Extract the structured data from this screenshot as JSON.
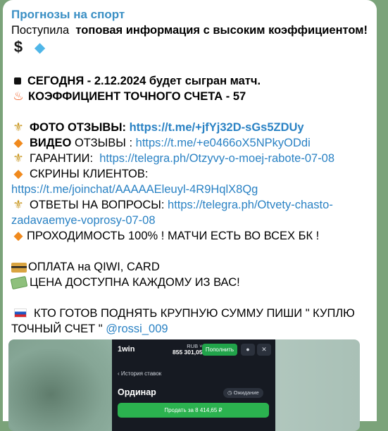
{
  "channel_name": "Прогнозы на спорт",
  "msg": {
    "intro_prefix": "Поступила",
    "intro_bold": "топовая информация с высоким  коэффициентом!",
    "today": "СЕГОДНЯ - 2.12.2024 будет сыгран матч.",
    "coef": "КОЭФФИЦИЕНТ ТОЧНОГО СЧЕТА  - 57",
    "photo_label": "ФОТО ОТЗЫВЫ:",
    "photo_link": "https://t.me/+jfYj32D-sGs5ZDUy",
    "video_bold": "ВИДЕО",
    "video_rest": " ОТЗЫВЫ :",
    "video_link": "https://t.me/+e0466oX5NPkyODdi",
    "guarantee_label": "ГАРАНТИИ:",
    "guarantee_link": "https://telegra.ph/Otzyvy-o-moej-rabote-07-08",
    "screens_label": "СКРИНЫ КЛИЕНТОВ:",
    "screens_link": "https://t.me/joinchat/AAAAAEleuyl-4R9HqlX8Qg",
    "answers_label": "ОТВЕТЫ НА ВОПРОСЫ:",
    "answers_link_1": "https://telegra.ph/Otvety-chasto-",
    "answers_link_2": "zadavaemye-voprosy-07-08",
    "pass_rate": "ПРОХОДИМОСТЬ 100% ! МАТЧИ ЕСТЬ ВО ВСЕХ БК !",
    "payment": "ОПЛАТА на QIWI, CARD",
    "price": "ЦЕНА ДОСТУПНА КАЖДОМУ ИЗ ВАС!",
    "cta_1": "КТО ГОТОВ ПОДНЯТЬ КРУПНУЮ СУММУ ПИШИ \" КУПЛЮ",
    "cta_2": "ТОЧНЫЙ СЧЕТ \"",
    "contact": "@rossi_009"
  },
  "preview": {
    "logo": "1win",
    "currency": "RUB ˅",
    "balance": "855 301,05",
    "deposit": "Пополнить",
    "history": "‹  История ставок",
    "bet_type": "Ординар",
    "status": "Ожидание",
    "pay_button": "Продать за 8 414,65 ₽"
  },
  "icons": {
    "dollar": "heavy-dollar-sign-icon",
    "gem": "gem-stone-icon",
    "square": "black-square-icon",
    "fire": "fire-icon",
    "fleur": "fleur-de-lis-icon",
    "diamond": "orange-diamond-icon",
    "card": "credit-card-icon",
    "cash": "money-with-wings-icon",
    "flag": "russia-flag-icon"
  },
  "colors": {
    "link": "#2a82c4",
    "channel": "#3a8fc4",
    "background": "#7ba37a"
  }
}
